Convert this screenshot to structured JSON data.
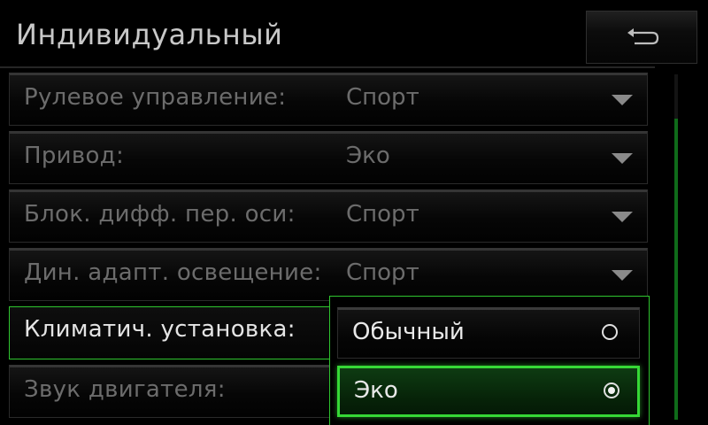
{
  "header": {
    "title": "Индивидуальный",
    "back_icon": "return-arrow-icon"
  },
  "settings": [
    {
      "label": "Рулевое управление:",
      "value": "Спорт"
    },
    {
      "label": "Привод:",
      "value": "Эко"
    },
    {
      "label": "Блок. дифф. пер. оси:",
      "value": "Спорт"
    },
    {
      "label": "Дин. адапт. освещение:",
      "value": "Спорт"
    },
    {
      "label": "Климатич. установка:",
      "value": ""
    },
    {
      "label": "Звук двигателя:",
      "value": ""
    }
  ],
  "dropdown": {
    "options": [
      {
        "label": "Обычный",
        "selected": false
      },
      {
        "label": "Эко",
        "selected": true
      }
    ]
  },
  "scrollbar": {
    "position_fraction": 0.13,
    "visible_fraction": 0.87
  },
  "colors": {
    "accent": "#2fc52f",
    "selected_fill": "#0e3b12",
    "scroll_thumb": "#0f6b1a",
    "inactive_text": "#6c6c6c",
    "active_text": "#e4e4e4"
  }
}
